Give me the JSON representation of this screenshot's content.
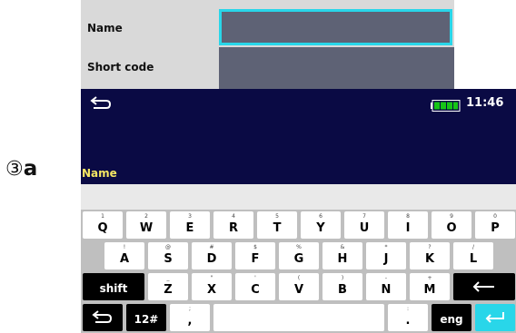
{
  "form": {
    "name_label": "Name",
    "short_code_label": "Short code"
  },
  "step_label": {
    "circle": "③",
    "letter": "a"
  },
  "status": {
    "time": "11:46",
    "battery_level": 1.0
  },
  "editor": {
    "field_title": "Name",
    "input_value": ""
  },
  "keyboard": {
    "row1": [
      {
        "sub": "1",
        "main": "Q"
      },
      {
        "sub": "2",
        "main": "W"
      },
      {
        "sub": "3",
        "main": "E"
      },
      {
        "sub": "4",
        "main": "R"
      },
      {
        "sub": "5",
        "main": "T"
      },
      {
        "sub": "6",
        "main": "Y"
      },
      {
        "sub": "7",
        "main": "U"
      },
      {
        "sub": "8",
        "main": "I"
      },
      {
        "sub": "9",
        "main": "O"
      },
      {
        "sub": "0",
        "main": "P"
      }
    ],
    "row2": [
      {
        "sub": "!",
        "main": "A"
      },
      {
        "sub": "@",
        "main": "S"
      },
      {
        "sub": "#",
        "main": "D"
      },
      {
        "sub": "$",
        "main": "F"
      },
      {
        "sub": "%",
        "main": "G"
      },
      {
        "sub": "&",
        "main": "H"
      },
      {
        "sub": "*",
        "main": "J"
      },
      {
        "sub": "?",
        "main": "K"
      },
      {
        "sub": "/",
        "main": "L"
      }
    ],
    "row3": [
      {
        "sub": "_",
        "main": "Z"
      },
      {
        "sub": "\"",
        "main": "X"
      },
      {
        "sub": "'",
        "main": "C"
      },
      {
        "sub": "(",
        "main": "V"
      },
      {
        "sub": ")",
        "main": "B"
      },
      {
        "sub": "-",
        "main": "N"
      },
      {
        "sub": "+",
        "main": "M"
      }
    ],
    "shift_label": "shift",
    "numeric_label": "12#",
    "comma": {
      "sub": ";",
      "main": ","
    },
    "period": {
      "sub": ":",
      "main": "."
    },
    "lang_label": "eng",
    "icons": {
      "back": "return-arrow-icon",
      "backspace": "backspace-arrow-icon",
      "enter": "enter-arrow-icon"
    },
    "colors": {
      "accent": "#29d6e9",
      "title_bar": "#0a0a44",
      "field_title": "#f5e663"
    }
  }
}
